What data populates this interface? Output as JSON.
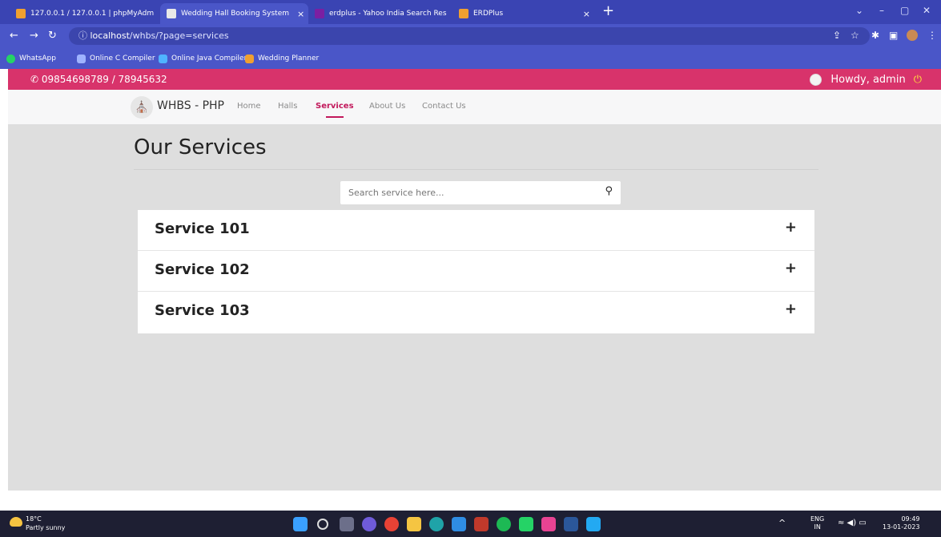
{
  "browser": {
    "tabs": [
      {
        "label": "127.0.0.1 / 127.0.0.1 | phpMyAdm",
        "color": "#f0a030"
      },
      {
        "label": "Wedding Hall Booking System",
        "color": "#ffffff"
      },
      {
        "label": "erdplus - Yahoo India Search Res",
        "color": "#7b1fa2"
      },
      {
        "label": "ERDPlus",
        "color": "#f0a030"
      }
    ],
    "url_host": "localhost",
    "url_path": "/whbs/?page=services",
    "bookmarks": [
      "WhatsApp",
      "Online C Compiler",
      "Online Java Compiler",
      "Wedding Planner"
    ]
  },
  "topbar": {
    "phone": "09854698789 / 78945632",
    "greeting": "Howdy, admin"
  },
  "nav": {
    "brand": "WHBS - PHP",
    "links": [
      "Home",
      "Halls",
      "Services",
      "About Us",
      "Contact Us"
    ],
    "active": "Services"
  },
  "page": {
    "title": "Our Services",
    "search_placeholder": "Search service here...",
    "services": [
      "Service 101",
      "Service 102",
      "Service 103"
    ],
    "toggle": "+"
  },
  "taskbar": {
    "temp": "18°C",
    "weather": "Partly sunny",
    "lang": "ENG",
    "region": "IN",
    "time": "09:49",
    "date": "13-01-2023"
  }
}
